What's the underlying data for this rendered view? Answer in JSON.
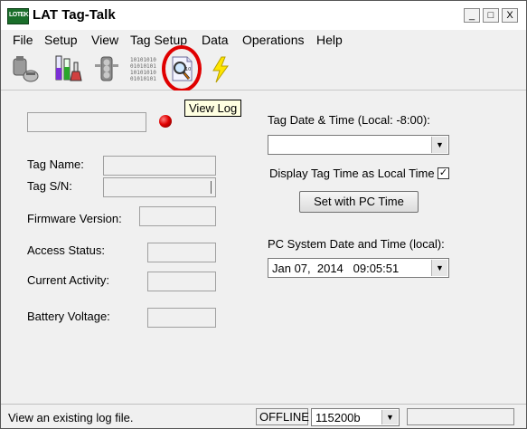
{
  "window": {
    "title": "LAT Tag-Talk",
    "icon_label": "LOTEK",
    "controls": {
      "minimize": "_",
      "maximize": "□",
      "close": "X"
    }
  },
  "menu": [
    "File",
    "Setup",
    "View",
    "Tag Setup",
    "Data",
    "Operations",
    "Help"
  ],
  "toolbar": {
    "tools": [
      "connect-tag-icon",
      "test-tubes-icon",
      "traffic-light-icon",
      "binary-data-icon",
      "view-log-icon",
      "lightning-icon"
    ],
    "tooltip": "View Log",
    "binary_text": [
      "10101010",
      "01010101",
      "10101010",
      "01010101"
    ]
  },
  "left_panel": {
    "tag_name_label": "Tag Name:",
    "tag_sn_label": "Tag S/N:",
    "firmware_label": "Firmware Version:",
    "access_status_label": "Access Status:",
    "current_activity_label": "Current Activity:",
    "battery_voltage_label": "Battery Voltage:"
  },
  "right_panel": {
    "tag_datetime_label": "Tag Date & Time (Local: -8:00):",
    "tag_datetime_value": "",
    "display_local_label": "Display Tag Time as Local Time",
    "display_local_checked": "✓",
    "set_pc_time_label": "Set with PC Time",
    "pc_datetime_label": "PC System Date and Time (local):",
    "pc_datetime_value": "Jan 07,  2014   09:05:51"
  },
  "status": {
    "message": "View an existing log file.",
    "connection": "OFFLINE",
    "baud": "115200b"
  },
  "colors": {
    "highlight": "#e00000",
    "led": "#e00000",
    "tooltip_bg": "#ffffe1"
  }
}
